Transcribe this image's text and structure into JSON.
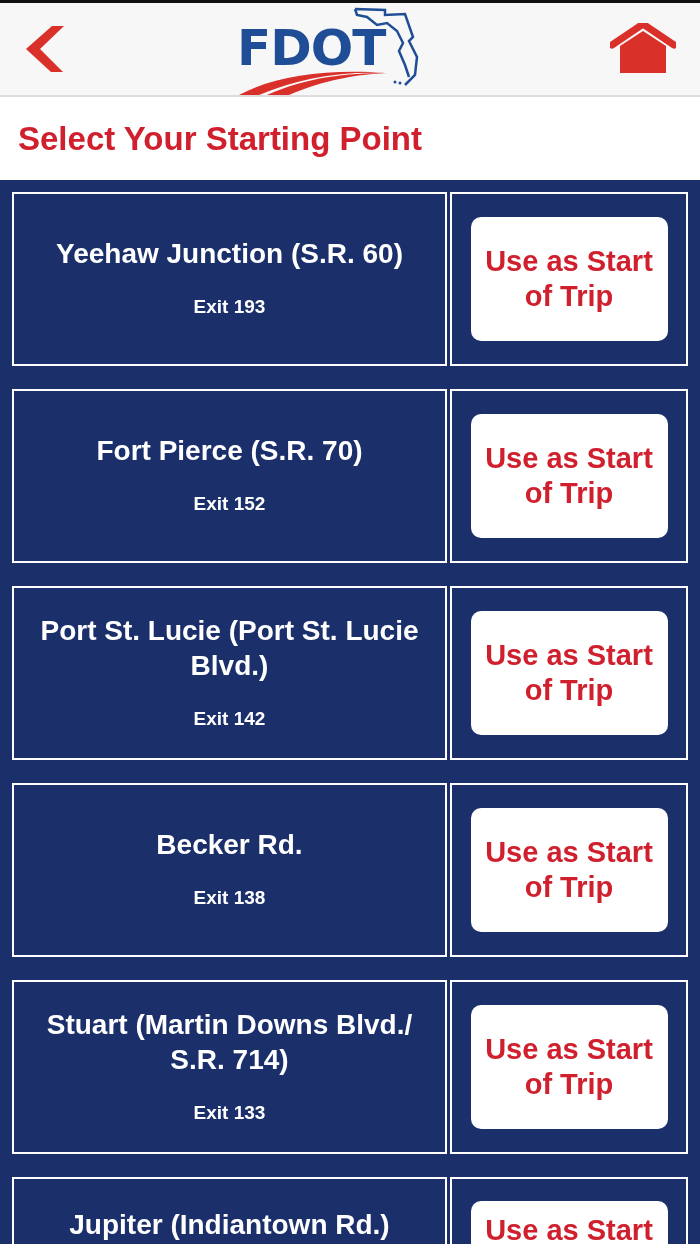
{
  "header": {
    "logo_text": "FDOT"
  },
  "title": "Select Your Starting Point",
  "exits": [
    {
      "name": "Yeehaw Junction (S.R. 60)",
      "exit": "Exit 193",
      "button": "Use as Start of Trip"
    },
    {
      "name": "Fort Pierce (S.R. 70)",
      "exit": "Exit 152",
      "button": "Use as Start of Trip"
    },
    {
      "name": "Port St. Lucie (Port St. Lucie Blvd.)",
      "exit": "Exit 142",
      "button": "Use as Start of Trip"
    },
    {
      "name": "Becker Rd.",
      "exit": "Exit 138",
      "button": "Use as Start of Trip"
    },
    {
      "name": "Stuart (Martin Downs Blvd./ S.R. 714)",
      "exit": "Exit 133",
      "button": "Use as Start of Trip"
    },
    {
      "name": "Jupiter (Indiantown Rd.)",
      "button": "Use as Start"
    }
  ]
}
